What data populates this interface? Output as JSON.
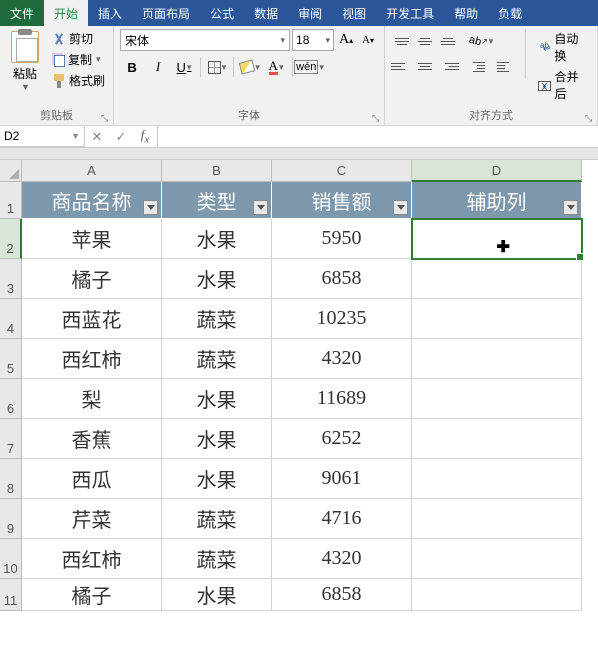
{
  "tabs": {
    "file": "文件",
    "home": "开始",
    "insert": "插入",
    "layout": "页面布局",
    "formula": "公式",
    "data": "数据",
    "review": "审阅",
    "view": "视图",
    "dev": "开发工具",
    "help": "帮助",
    "load": "负载"
  },
  "ribbon": {
    "clipboard": {
      "paste": "粘贴",
      "cut": "剪切",
      "copy": "复制",
      "brush": "格式刷",
      "label": "剪贴板"
    },
    "font": {
      "name": "宋体",
      "size": "18",
      "bold": "B",
      "italic": "I",
      "underline": "U",
      "wen": "wén",
      "label": "字体"
    },
    "align": {
      "wrap": "自动换",
      "merge": "合并后",
      "label": "对齐方式"
    }
  },
  "nameBox": "D2",
  "headers": {
    "A": "A",
    "B": "B",
    "C": "C",
    "D": "D"
  },
  "tableHeaders": {
    "a": "商品名称",
    "b": "类型",
    "c": "销售额",
    "d": "辅助列"
  },
  "rows": [
    {
      "n": "1"
    },
    {
      "n": "2",
      "a": "苹果",
      "b": "水果",
      "c": "5950",
      "d": ""
    },
    {
      "n": "3",
      "a": "橘子",
      "b": "水果",
      "c": "6858",
      "d": ""
    },
    {
      "n": "4",
      "a": "西蓝花",
      "b": "蔬菜",
      "c": "10235",
      "d": ""
    },
    {
      "n": "5",
      "a": "西红柿",
      "b": "蔬菜",
      "c": "4320",
      "d": ""
    },
    {
      "n": "6",
      "a": "梨",
      "b": "水果",
      "c": "11689",
      "d": ""
    },
    {
      "n": "7",
      "a": "香蕉",
      "b": "水果",
      "c": "6252",
      "d": ""
    },
    {
      "n": "8",
      "a": "西瓜",
      "b": "水果",
      "c": "9061",
      "d": ""
    },
    {
      "n": "9",
      "a": "芹菜",
      "b": "蔬菜",
      "c": "4716",
      "d": ""
    },
    {
      "n": "10",
      "a": "西红柿",
      "b": "蔬菜",
      "c": "4320",
      "d": ""
    },
    {
      "n": "11",
      "a": "橘子",
      "b": "水果",
      "c": "6858",
      "d": ""
    }
  ]
}
